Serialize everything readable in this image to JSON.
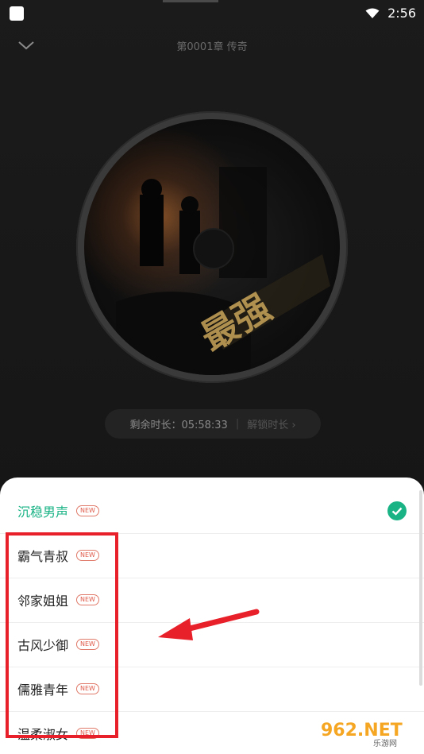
{
  "status_bar": {
    "time": "2:56"
  },
  "header": {
    "chapter_title": "第0001章 传奇"
  },
  "player": {
    "remaining_label": "剩余时长：05:58:33",
    "separator": "|",
    "unlock_label": "解锁时长 ›"
  },
  "cover_text": "最强",
  "voices": [
    {
      "label": "沉稳男声",
      "badge": "NEW",
      "selected": true
    },
    {
      "label": "霸气青叔",
      "badge": "NEW",
      "selected": false
    },
    {
      "label": "邻家姐姐",
      "badge": "NEW",
      "selected": false
    },
    {
      "label": "古风少御",
      "badge": "NEW",
      "selected": false
    },
    {
      "label": "儒雅青年",
      "badge": "NEW",
      "selected": false
    },
    {
      "label": "温柔淑女",
      "badge": "NEW",
      "selected": false
    }
  ],
  "watermark": {
    "brand": "962.NET",
    "sub": "乐游网"
  },
  "colors": {
    "accent": "#1ab386",
    "annotation": "#e8202a",
    "badge": "#e05a4a"
  }
}
